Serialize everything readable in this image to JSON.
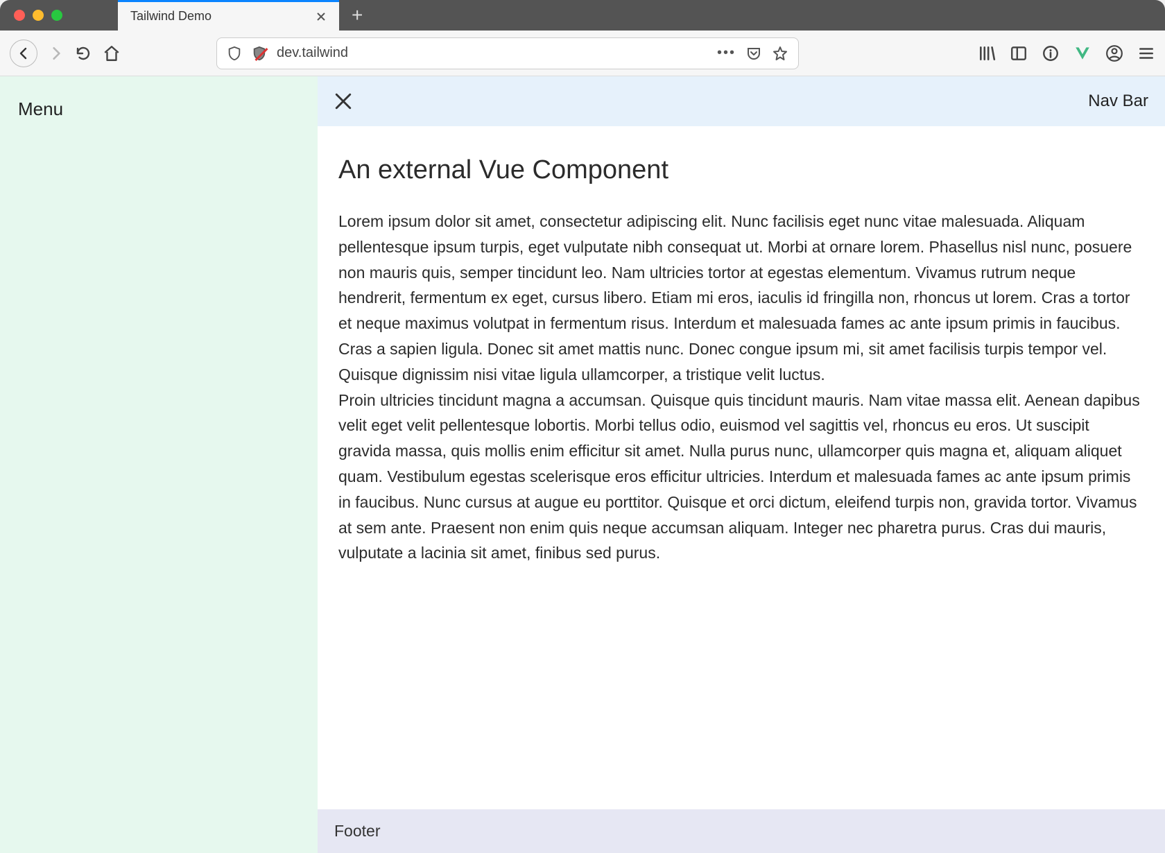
{
  "browser": {
    "tab_title": "Tailwind Demo",
    "url": "dev.tailwind"
  },
  "sidebar": {
    "menu_label": "Menu"
  },
  "navbar": {
    "title": "Nav Bar"
  },
  "content": {
    "heading": "An external Vue Component",
    "para1": "Lorem ipsum dolor sit amet, consectetur adipiscing elit. Nunc facilisis eget nunc vitae malesuada. Aliquam pellentesque ipsum turpis, eget vulputate nibh consequat ut. Morbi at ornare lorem. Phasellus nisl nunc, posuere non mauris quis, semper tincidunt leo. Nam ultricies tortor at egestas elementum. Vivamus rutrum neque hendrerit, fermentum ex eget, cursus libero. Etiam mi eros, iaculis id fringilla non, rhoncus ut lorem. Cras a tortor et neque maximus volutpat in fermentum risus. Interdum et malesuada fames ac ante ipsum primis in faucibus. Cras a sapien ligula. Donec sit amet mattis nunc. Donec congue ipsum mi, sit amet facilisis turpis tempor vel. Quisque dignissim nisi vitae ligula ullamcorper, a tristique velit luctus.",
    "para2": "Proin ultricies tincidunt magna a accumsan. Quisque quis tincidunt mauris. Nam vitae massa elit. Aenean dapibus velit eget velit pellentesque lobortis. Morbi tellus odio, euismod vel sagittis vel, rhoncus eu eros. Ut suscipit gravida massa, quis mollis enim efficitur sit amet. Nulla purus nunc, ullamcorper quis magna et, aliquam aliquet quam. Vestibulum egestas scelerisque eros efficitur ultricies. Interdum et malesuada fames ac ante ipsum primis in faucibus. Nunc cursus at augue eu porttitor. Quisque et orci dictum, eleifend turpis non, gravida tortor. Vivamus at sem ante. Praesent non enim quis neque accumsan aliquam. Integer nec pharetra purus. Cras dui mauris, vulputate a lacinia sit amet, finibus sed purus."
  },
  "footer": {
    "label": "Footer"
  }
}
